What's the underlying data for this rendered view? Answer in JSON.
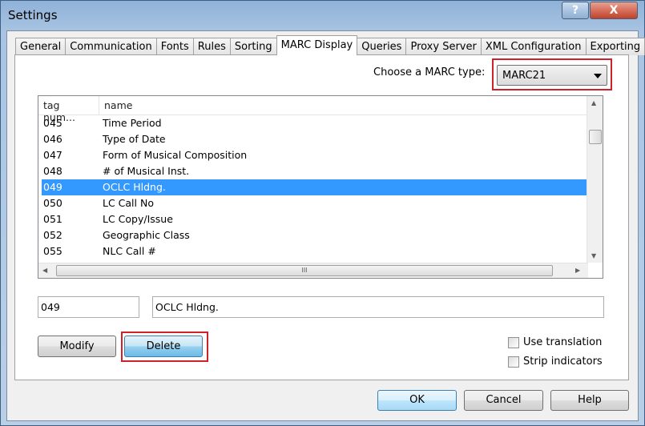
{
  "window": {
    "title": "Settings",
    "help_glyph": "?",
    "close_glyph": "X"
  },
  "tabs": [
    {
      "label": "General"
    },
    {
      "label": "Communication"
    },
    {
      "label": "Fonts"
    },
    {
      "label": "Rules"
    },
    {
      "label": "Sorting"
    },
    {
      "label": "MARC Display",
      "active": true
    },
    {
      "label": "Queries"
    },
    {
      "label": "Proxy Server"
    },
    {
      "label": "XML Configuration"
    },
    {
      "label": "Exporting"
    }
  ],
  "marc_type": {
    "label": "Choose a MARC type:",
    "value": "MARC21"
  },
  "list": {
    "columns": [
      "tag num...",
      "name"
    ],
    "rows": [
      {
        "tag": "045",
        "name": "Time Period"
      },
      {
        "tag": "046",
        "name": "Type of Date"
      },
      {
        "tag": "047",
        "name": "Form of Musical Composition"
      },
      {
        "tag": "048",
        "name": "# of Musical Inst."
      },
      {
        "tag": "049",
        "name": "OCLC Hldng.",
        "selected": true
      },
      {
        "tag": "050",
        "name": "LC Call No"
      },
      {
        "tag": "051",
        "name": "LC Copy/Issue"
      },
      {
        "tag": "052",
        "name": "Geographic Class"
      },
      {
        "tag": "055",
        "name": "NLC Call #"
      }
    ],
    "hscroll_grip": "III"
  },
  "edit": {
    "tag_value": "049",
    "name_value": "OCLC Hldng."
  },
  "buttons": {
    "modify": "Modify",
    "delete": "Delete",
    "ok": "OK",
    "cancel": "Cancel",
    "help": "Help"
  },
  "options": {
    "use_translation": {
      "label": "Use translation",
      "checked": false
    },
    "strip_indicators": {
      "label": "Strip indicators",
      "checked": false
    }
  },
  "colors": {
    "selection": "#3399ff",
    "highlight_box": "#d0202a"
  }
}
